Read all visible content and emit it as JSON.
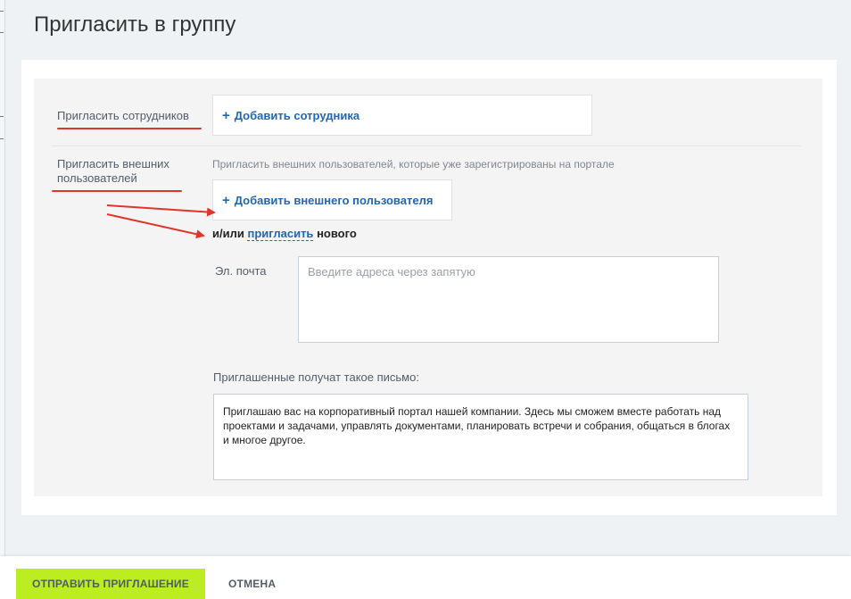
{
  "title": "Пригласить в группу",
  "employees": {
    "label": "Пригласить сотрудников",
    "add_label": "Добавить сотрудника"
  },
  "external": {
    "label_line1": "Пригласить внешних",
    "label_line2": "пользователей",
    "hint": "Пригласить внешних пользователей, которые уже зарегистрированы на портале",
    "add_label": "Добавить внешнего пользователя",
    "or_prefix": "и/или",
    "or_link": "пригласить",
    "or_suffix": "нового"
  },
  "email": {
    "label": "Эл. почта",
    "placeholder": "Введите адреса через запятую",
    "value": ""
  },
  "letter": {
    "caption": "Приглашенные получат такое письмо:",
    "text": "Приглашаю вас на корпоративный портал нашей компании. Здесь мы сможем вместе работать над проектами и задачами, управлять документами, планировать встречи и собрания, общаться в блогах и многое другое."
  },
  "footer": {
    "send_label": "Отправить приглашение",
    "cancel_label": "Отмена"
  },
  "colors": {
    "link": "#2067b0",
    "annotation": "#e0352b",
    "send_button": "#bbed21"
  }
}
